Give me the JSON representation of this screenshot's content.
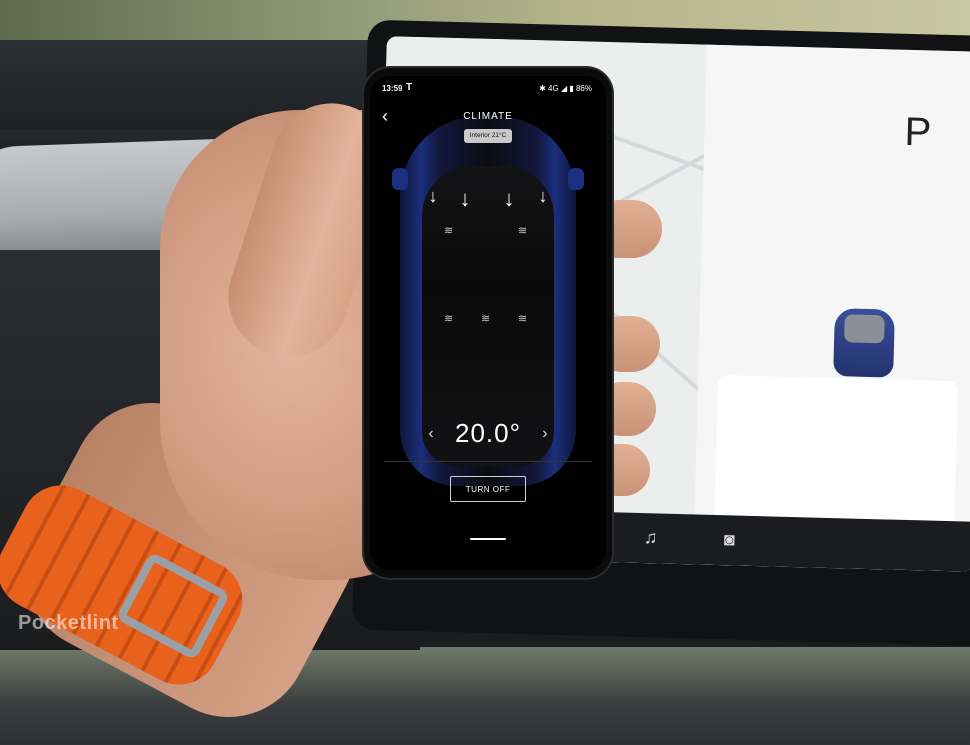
{
  "watermark": "Pocketlint",
  "colors": {
    "app_background": "#000000",
    "car_blue": "#1c2e7d",
    "text_primary": "#ffffff",
    "chip_bg": "#c9c9c9",
    "watch_band": "#e8611d"
  },
  "phone": {
    "status_bar": {
      "time": "13:59",
      "carrier_icon": "T",
      "network": "4G",
      "battery": "86%"
    },
    "header": {
      "back_icon": "chevron-left-icon",
      "title": "CLIMATE",
      "interior_chip": "Interior 21°C"
    },
    "airflow": {
      "arrow_icons": [
        "↓",
        "↓",
        "↓",
        "↓"
      ]
    },
    "seat_heaters": {
      "icon": "heat-wave-icon",
      "glyph": "≋"
    },
    "temperature": {
      "value": "20.0",
      "unit": "°",
      "decrease_icon": "‹",
      "increase_icon": "›"
    },
    "turn_off_label": "TURN OFF"
  },
  "center_screen": {
    "gear": "P"
  }
}
